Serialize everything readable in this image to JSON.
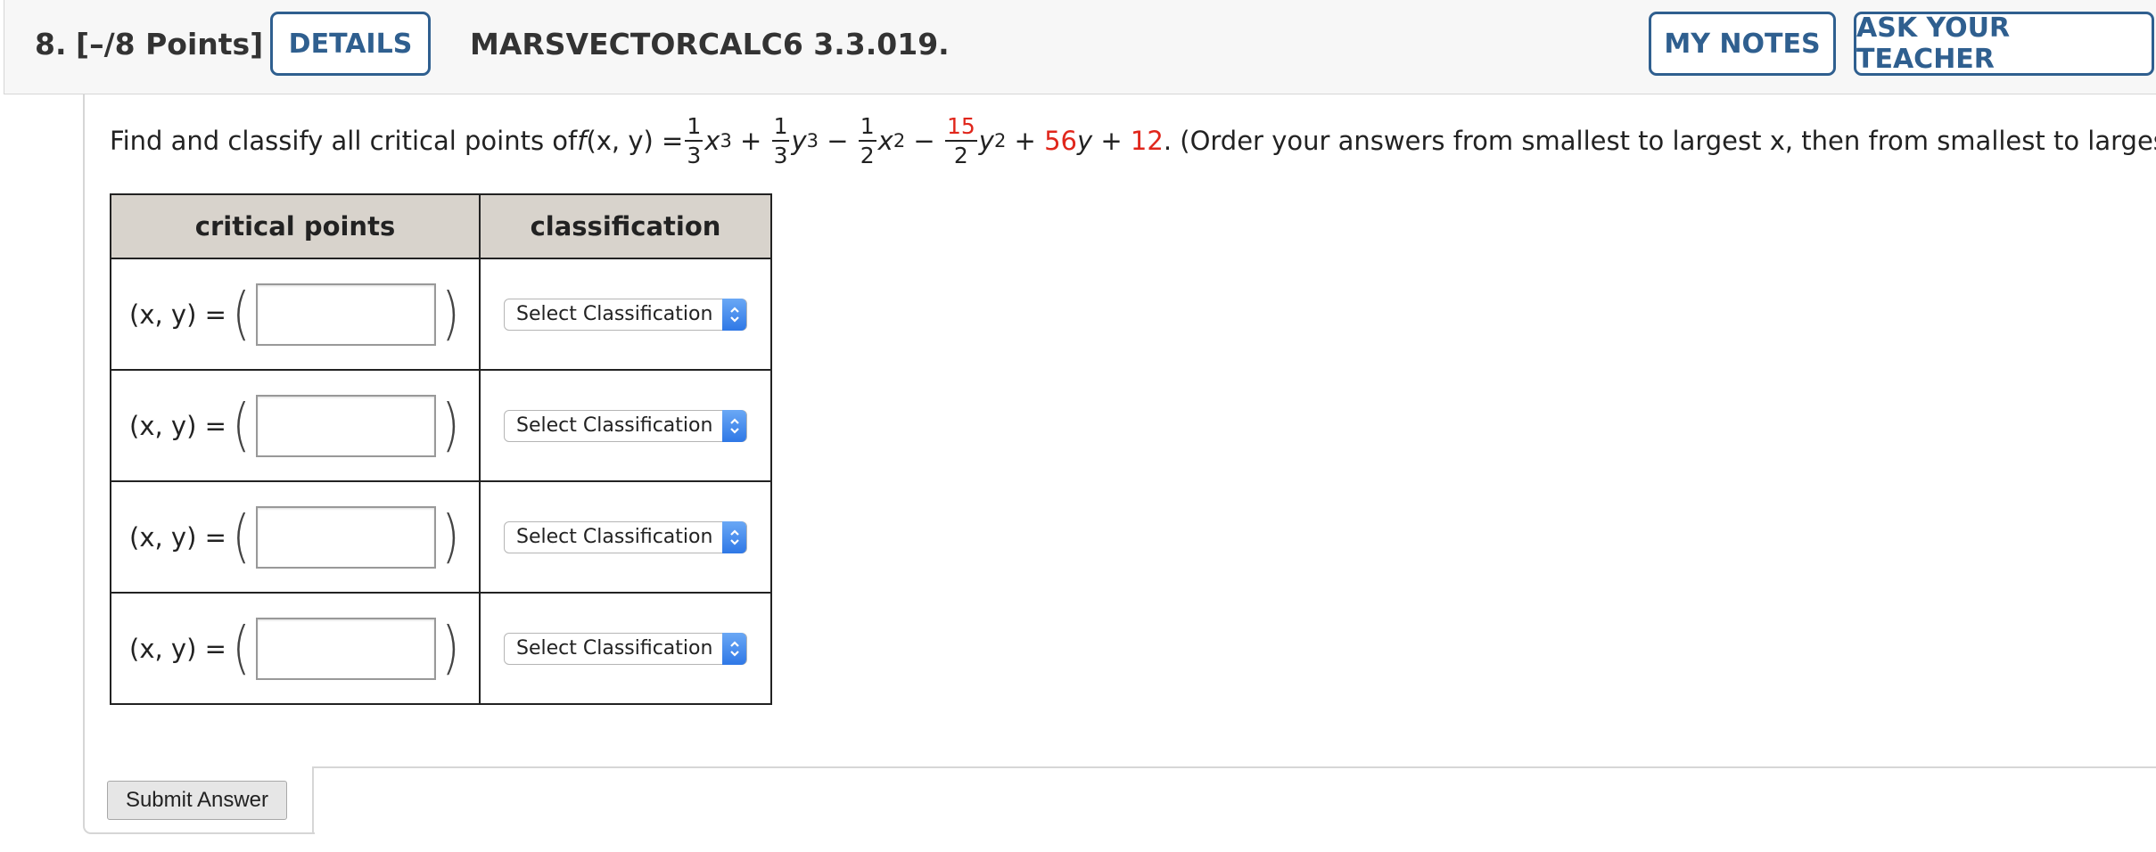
{
  "header": {
    "question_number": "8.",
    "points": "[–/8 Points]",
    "details_label": "DETAILS",
    "reference": "MARSVECTORCALC6 3.3.019.",
    "my_notes_label": "MY NOTES",
    "ask_teacher_label": "ASK YOUR TEACHER"
  },
  "prompt": {
    "lead": "Find and classify all critical points of ",
    "func": "f",
    "args": "(x, y) = ",
    "term1_num": "1",
    "term1_den": "3",
    "term1_var": "x",
    "term1_exp": "3",
    "plus1": " + ",
    "term2_num": "1",
    "term2_den": "3",
    "term2_var": "y",
    "term2_exp": "3",
    "minus1": " − ",
    "term3_num": "1",
    "term3_den": "2",
    "term3_var": "x",
    "term3_exp": "2",
    "minus2": " − ",
    "term4_num": "15",
    "term4_den": "2",
    "term4_var": "y",
    "term4_exp": "2",
    "plus2": " + ",
    "coef5": "56",
    "term5_var": "y",
    "plus3": " + ",
    "const": "12",
    "tail": ". (Order your answers from smallest to largest x, then from smallest to largest y.)"
  },
  "table": {
    "col_critical": "critical points",
    "col_class": "classification",
    "row_label": "(x, y) =",
    "rows": [
      {
        "answer": "",
        "classification": "Select Classification"
      },
      {
        "answer": "",
        "classification": "Select Classification"
      },
      {
        "answer": "",
        "classification": "Select Classification"
      },
      {
        "answer": "",
        "classification": "Select Classification"
      }
    ]
  },
  "submit_label": "Submit Answer",
  "colors": {
    "accent": "#2f5f8f",
    "highlight": "#e0261b",
    "header_bg": "#d8d3cc"
  }
}
